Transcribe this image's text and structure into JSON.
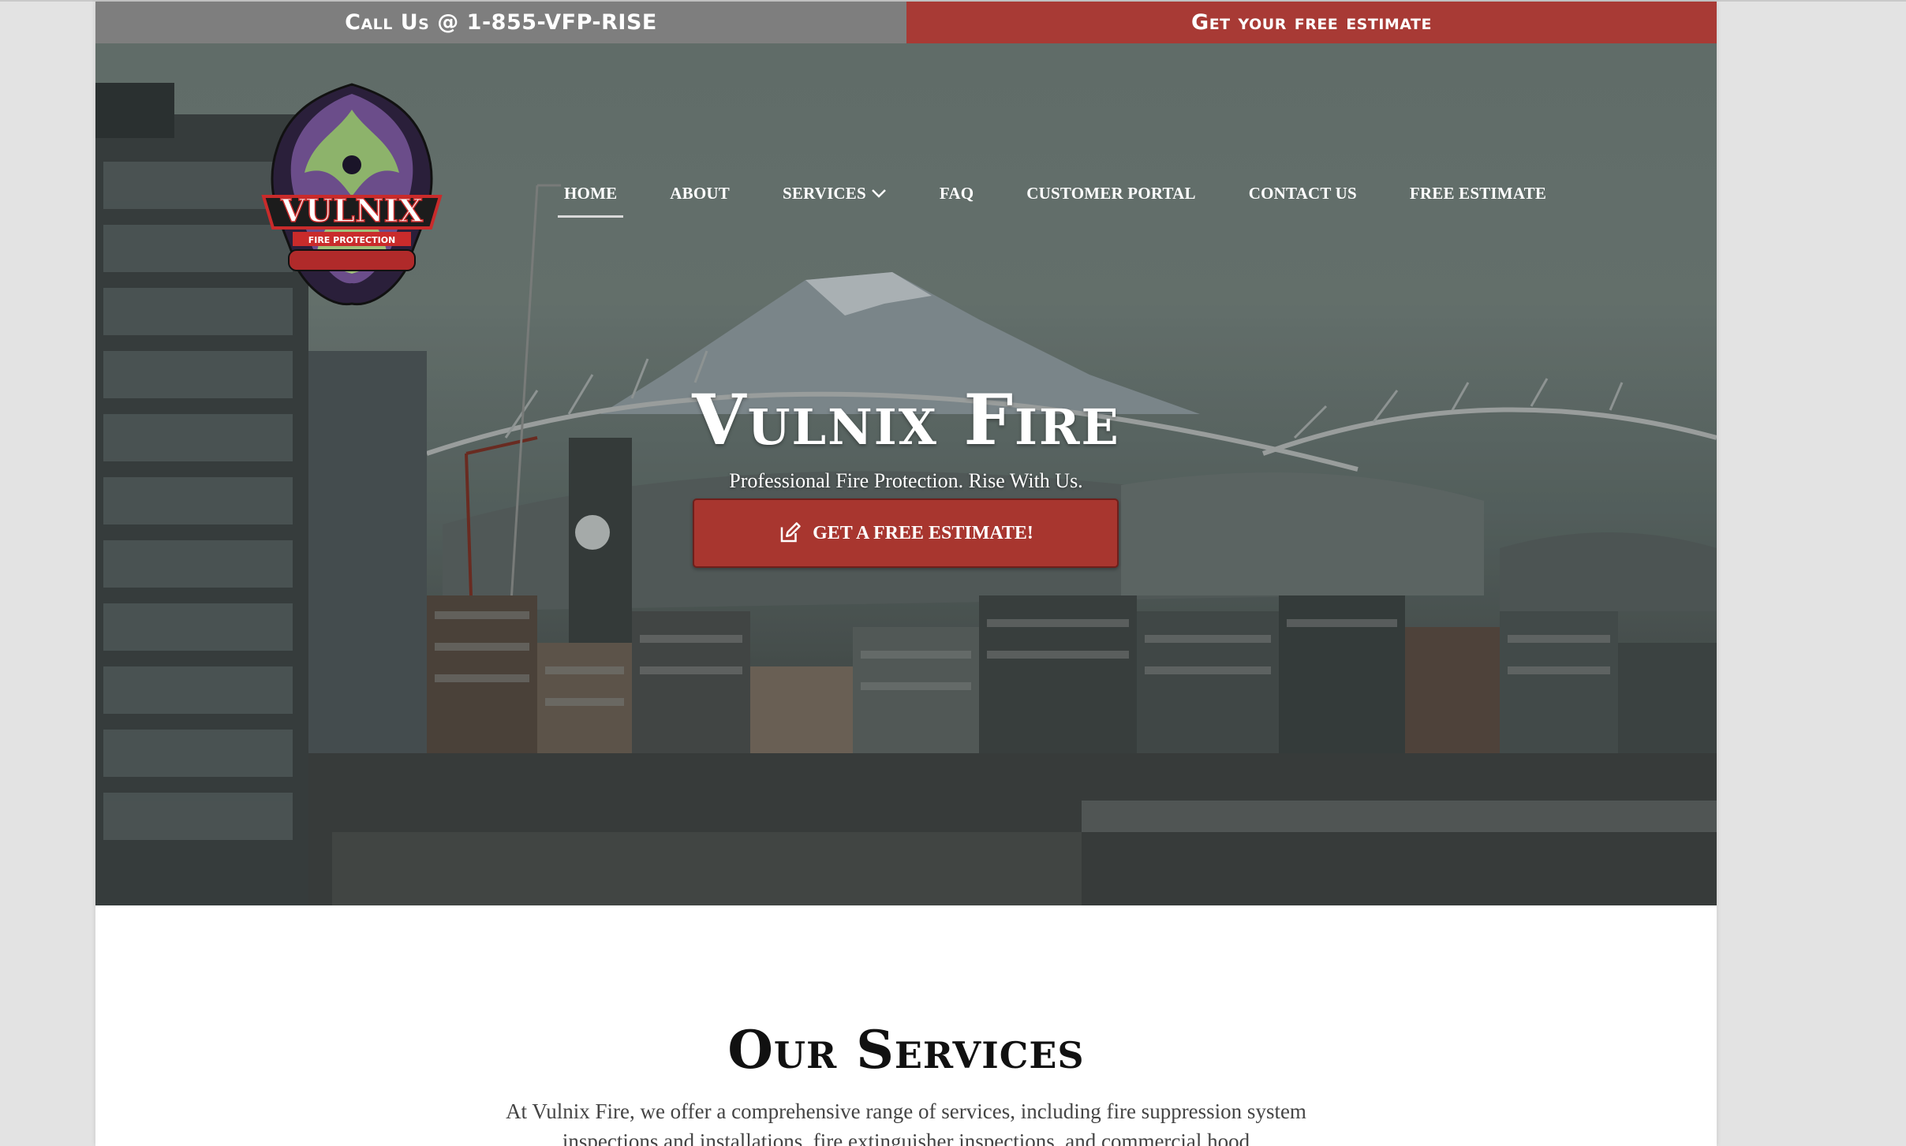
{
  "topbar": {
    "call_label": "Call Us @ 1-855-VFP-RISE",
    "estimate_label": "Get your free estimate"
  },
  "nav": {
    "items": [
      {
        "label": "HOME",
        "active": true
      },
      {
        "label": "ABOUT"
      },
      {
        "label": "SERVICES",
        "has_dropdown": true
      },
      {
        "label": "FAQ"
      },
      {
        "label": "CUSTOMER PORTAL"
      },
      {
        "label": "CONTACT US"
      },
      {
        "label": "FREE ESTIMATE"
      }
    ]
  },
  "logo": {
    "wordmark": "VULNIX",
    "tagline": "FIRE PROTECTION"
  },
  "hero": {
    "title": "Vulnix Fire",
    "subtitle": "Professional Fire Protection. Rise With Us.",
    "cta_label": "GET A FREE ESTIMATE!",
    "cta_icon": "edit-icon"
  },
  "services": {
    "title": "Our Services",
    "intro": "At Vulnix Fire, we offer a comprehensive range of services, including fire suppression system inspections and installations, fire extinguisher inspections, and commercial hood"
  },
  "colors": {
    "accent_red": "#a83a35",
    "topbar_gray": "#7e7e7e"
  }
}
